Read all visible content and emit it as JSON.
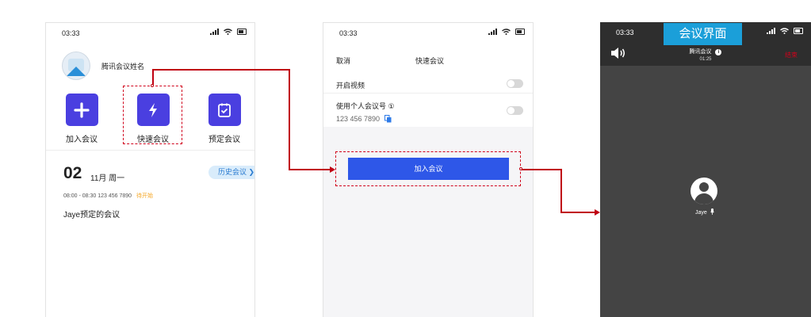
{
  "screen1": {
    "time": "03:33",
    "username": "腾讯会议姓名",
    "features": [
      {
        "label": "加入会议",
        "icon": "plus-icon"
      },
      {
        "label": "快速会议",
        "icon": "lightning-icon"
      },
      {
        "label": "预定会议",
        "icon": "calendar-check-icon"
      }
    ],
    "date_day": "02",
    "date_rest": "11月 周一",
    "history_label": "历史会议",
    "meeting_time": "08:00 - 08:30  123 456 7890",
    "meeting_status": "待开始",
    "meeting_name": "Jaye预定的会议"
  },
  "screen2": {
    "time": "03:33",
    "cancel_label": "取消",
    "title": "快速会议",
    "option_video": "开启视频",
    "option_personal_id": "使用个人会议号 ①",
    "personal_id": "123 456 7890",
    "join_label": "加入会议"
  },
  "screen3": {
    "time": "03:33",
    "label_tag": "会议界面",
    "meeting_title": "腾讯会议",
    "duration": "01:25",
    "end_label": "结束",
    "user_name": "Jaye"
  },
  "colors": {
    "accent_purple": "#4a3fe0",
    "button_blue": "#2e57e8",
    "tag_blue": "#1b9fd9",
    "connector_red": "#c00012",
    "meeting_bg": "#444444"
  }
}
